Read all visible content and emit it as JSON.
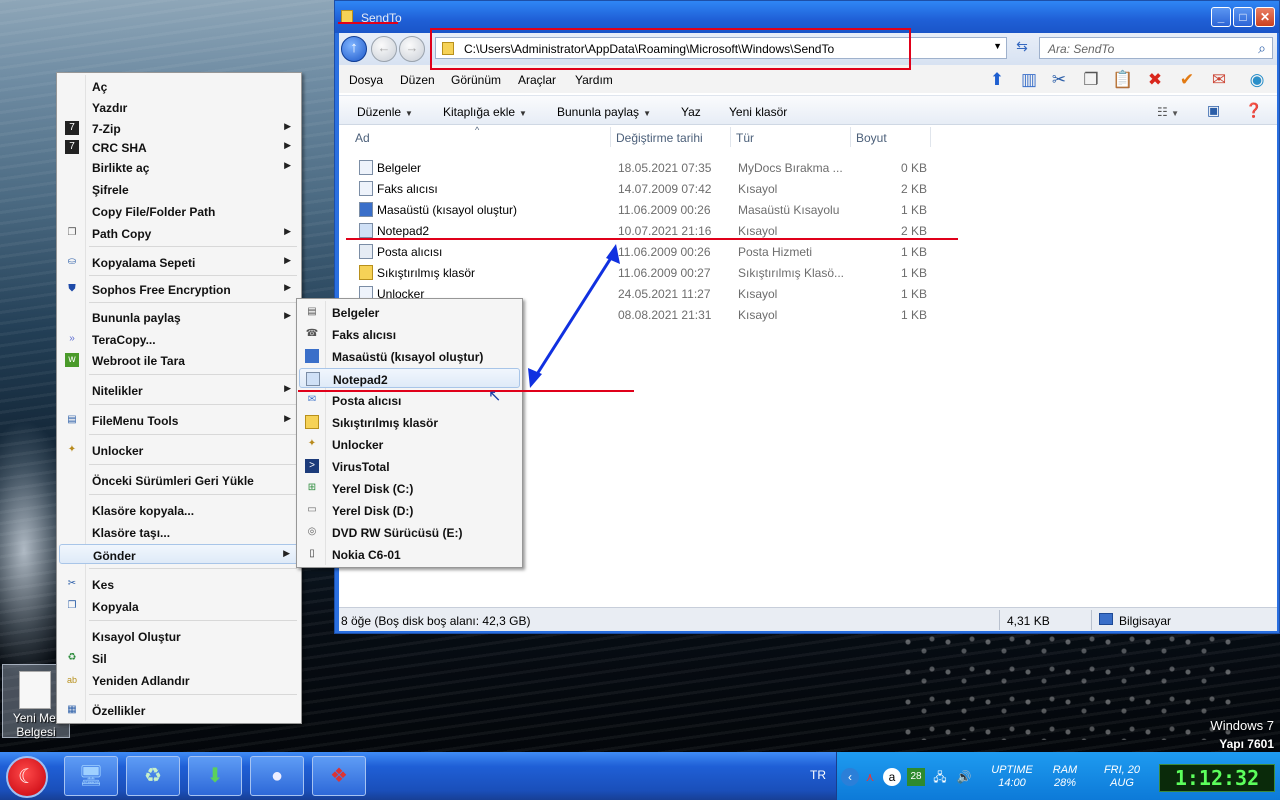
{
  "window": {
    "title": "SendTo",
    "address": "C:\\Users\\Administrator\\AppData\\Roaming\\Microsoft\\Windows\\SendTo",
    "search_placeholder": "Ara: SendTo",
    "menu": [
      "Dosya",
      "Düzen",
      "Görünüm",
      "Araçlar",
      "Yardım"
    ],
    "commands": {
      "organize": "Düzenle",
      "add_library": "Kitaplığa ekle",
      "share": "Bununla paylaş",
      "burn": "Yaz",
      "new_folder": "Yeni klasör"
    },
    "columns": {
      "name": "Ad",
      "date": "Değiştirme tarihi",
      "type": "Tür",
      "size": "Boyut"
    },
    "files": [
      {
        "name": "Belgeler",
        "date": "18.05.2021 07:35",
        "type": "MyDocs Bırakma ...",
        "size": "0 KB"
      },
      {
        "name": "Faks alıcısı",
        "date": "14.07.2009 07:42",
        "type": "Kısayol",
        "size": "2 KB"
      },
      {
        "name": "Masaüstü (kısayol oluştur)",
        "date": "11.06.2009 00:26",
        "type": "Masaüstü Kısayolu",
        "size": "1 KB"
      },
      {
        "name": "Notepad2",
        "date": "10.07.2021 21:16",
        "type": "Kısayol",
        "size": "2 KB"
      },
      {
        "name": "Posta alıcısı",
        "date": "11.06.2009 00:26",
        "type": "Posta Hizmeti",
        "size": "1 KB"
      },
      {
        "name": "Sıkıştırılmış klasör",
        "date": "11.06.2009 00:27",
        "type": "Sıkıştırılmış Klasö...",
        "size": "1 KB"
      },
      {
        "name": "Unlocker",
        "date": "24.05.2021 11:27",
        "type": "Kısayol",
        "size": "1 KB"
      },
      {
        "name": "",
        "date": "08.08.2021 21:31",
        "type": "Kısayol",
        "size": "1 KB"
      }
    ],
    "status": {
      "items": "8 öğe (Boş disk boş alanı: 42,3 GB)",
      "size": "4,31 KB",
      "location": "Bilgisayar"
    }
  },
  "context_menu": [
    {
      "label": "Aç"
    },
    {
      "label": "Yazdır"
    },
    {
      "label": "7-Zip",
      "sub": true
    },
    {
      "label": "CRC SHA",
      "sub": true
    },
    {
      "label": "Birlikte aç",
      "sub": true
    },
    {
      "label": "Şifrele"
    },
    {
      "label": "Copy File/Folder Path"
    },
    {
      "label": "Path Copy",
      "sub": true
    },
    {
      "label": "Kopyalama Sepeti",
      "sub": true
    },
    {
      "label": "Sophos Free Encryption",
      "sub": true
    },
    {
      "label": "Bununla paylaş",
      "sub": true
    },
    {
      "label": "TeraCopy..."
    },
    {
      "label": "Webroot ile Tara"
    },
    {
      "label": "Nitelikler",
      "sub": true
    },
    {
      "label": "FileMenu Tools",
      "sub": true
    },
    {
      "label": "Unlocker"
    },
    {
      "label": "Önceki Sürümleri Geri Yükle"
    },
    {
      "label": "Klasöre kopyala..."
    },
    {
      "label": "Klasöre taşı..."
    },
    {
      "label": "Gönder",
      "sub": true
    },
    {
      "label": "Kes"
    },
    {
      "label": "Kopyala"
    },
    {
      "label": "Kısayol Oluştur"
    },
    {
      "label": "Sil"
    },
    {
      "label": "Yeniden Adlandır"
    },
    {
      "label": "Özellikler"
    }
  ],
  "send_to_menu": [
    "Belgeler",
    "Faks alıcısı",
    "Masaüstü (kısayol oluştur)",
    "Notepad2",
    "Posta alıcısı",
    "Sıkıştırılmış klasör",
    "Unlocker",
    "VirusTotal",
    "Yerel Disk (C:)",
    "Yerel Disk (D:)",
    "DVD RW Sürücüsü (E:)",
    "Nokia C6-01"
  ],
  "desktop": {
    "icon_label_line1": "Yeni Met",
    "icon_label_line2": "Belgesi",
    "watermark_line1": "Windows 7",
    "watermark_line2": "Yapı 7601"
  },
  "taskbar": {
    "lang": "TR",
    "tray_badge": "28",
    "uptime_label": "UPTIME",
    "uptime_value": "14:00",
    "ram_label": "RAM",
    "ram_value": "28%",
    "date_line1": "FRI, 20",
    "date_line2": "AUG",
    "clock": "1:12:32"
  },
  "colors": {
    "annotation_red": "#e0001a",
    "annotation_blue": "#1030e0",
    "titlebar": "#1f5fd6"
  }
}
